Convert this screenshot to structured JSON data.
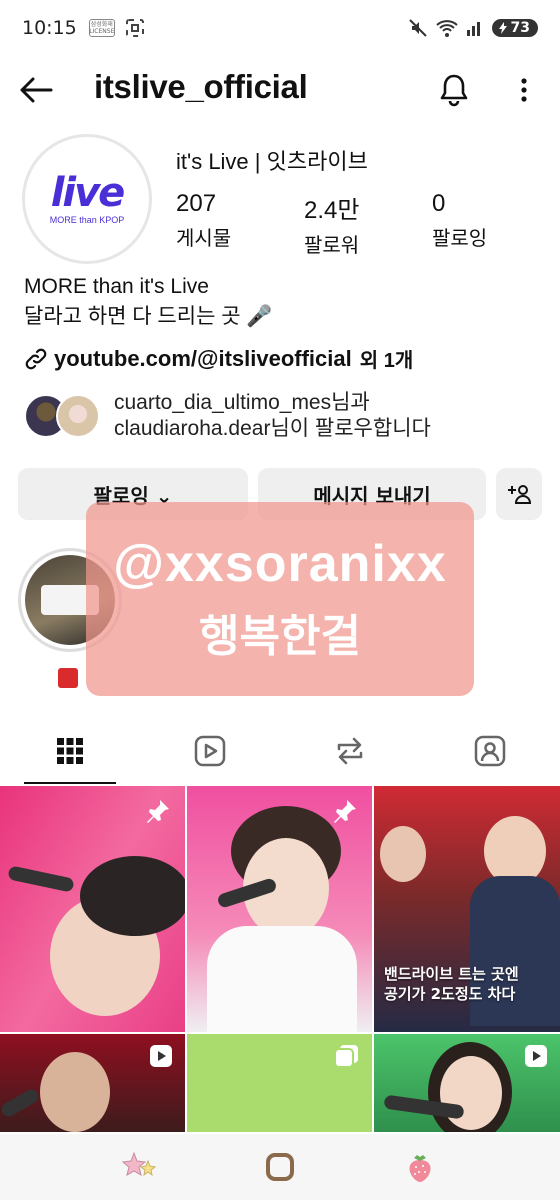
{
  "status_bar": {
    "time": "10:15",
    "chip_text": "삼성화재 LICENSE",
    "battery": "73"
  },
  "header": {
    "username": "itslive_official"
  },
  "profile": {
    "avatar_logo": "live",
    "avatar_sub": "MORE than KPOP",
    "display_name": "it's Live | 잇츠라이브",
    "stats": [
      {
        "value": "207",
        "label": "게시물"
      },
      {
        "value": "2.4만",
        "label": "팔로워"
      },
      {
        "value": "0",
        "label": "팔로잉"
      }
    ],
    "bio_line1": "MORE than it's Live",
    "bio_line2": "달라고 하면 다 드리는 곳 🎤",
    "link_text": "youtube.com/@itsliveofficial",
    "link_more": "외 1개",
    "followed_line1": "cuarto_dia_ultimo_mes님과",
    "followed_line2": "claudiaroha.dear님이 팔로우합니다"
  },
  "buttons": {
    "following": "팔로잉 ⌄",
    "message": "메시지 보내기"
  },
  "overlay": {
    "line1": "@xxsoranixx",
    "line2": "행복한걸"
  },
  "grid": {
    "caption_line1": "밴드라이브 트는 곳엔",
    "caption_line2": "공기가 2도정도 차다"
  },
  "icons": [
    "back-arrow-icon",
    "bell-icon",
    "more-vert-icon",
    "link-icon",
    "add-person-icon",
    "grid-icon",
    "reels-icon",
    "repost-icon",
    "tagged-icon",
    "pin-icon",
    "reel-icon",
    "star-icon",
    "home-icon",
    "strawberry-icon"
  ]
}
